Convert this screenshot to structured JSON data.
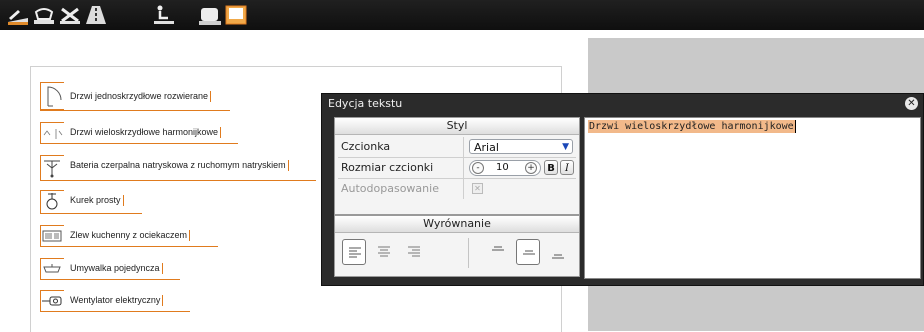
{
  "toolbar": {
    "tools": [
      {
        "name": "sloped-edge-tool-icon"
      },
      {
        "name": "bowl-tool-icon"
      },
      {
        "name": "cross-tool-icon"
      },
      {
        "name": "road-tool-icon"
      },
      {
        "name": "person-tool-icon"
      },
      {
        "name": "sink-tool-icon"
      },
      {
        "name": "box-tool-icon"
      }
    ]
  },
  "legend": {
    "items": [
      {
        "label": "Drzwi jednoskrzydłowe rozwierane",
        "icon": "door-single-icon"
      },
      {
        "label": "Drzwi wieloskrzydłowe harmonijkowe",
        "icon": "door-folding-icon"
      },
      {
        "label": "Bateria czerpalna natryskowa z ruchomym natryskiem",
        "icon": "shower-tap-icon"
      },
      {
        "label": "Kurek prosty",
        "icon": "valve-icon"
      },
      {
        "label": "Zlew kuchenny z ociekaczem",
        "icon": "kitchen-sink-icon"
      },
      {
        "label": "Umywalka pojedyncza",
        "icon": "washbasin-icon"
      },
      {
        "label": "Wentylator elektryczny",
        "icon": "fan-icon"
      }
    ]
  },
  "dialog": {
    "title": "Edycja tekstu",
    "style_panel": {
      "header": "Styl",
      "font_label": "Czcionka",
      "font_value": "Arial",
      "size_label": "Rozmiar czcionki",
      "size_value": "10",
      "minus": "-",
      "plus": "+",
      "bold": "B",
      "italic": "I",
      "autofit_label": "Autodopasowanie"
    },
    "align_panel": {
      "header": "Wyrównanie"
    },
    "editor_text": "Drzwi wieloskrzydłowe harmonijkowe"
  },
  "colors": {
    "accent": "#e07b1e",
    "selection": "#f2b98a",
    "dialog_bg": "#2b2b2b",
    "gray_area": "#c9c9c9"
  }
}
